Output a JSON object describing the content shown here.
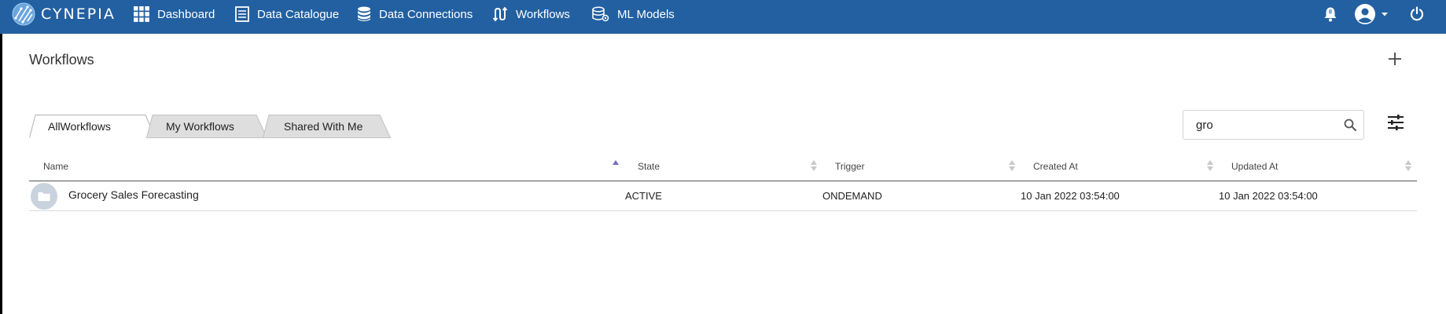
{
  "brand": {
    "name": "CYNEPIA"
  },
  "nav": [
    {
      "label": "Dashboard",
      "icon": "grid-icon"
    },
    {
      "label": "Data Catalogue",
      "icon": "catalogue-icon"
    },
    {
      "label": "Data Connections",
      "icon": "database-icon"
    },
    {
      "label": "Workflows",
      "icon": "workflow-icon"
    },
    {
      "label": "ML Models",
      "icon": "ml-models-icon"
    }
  ],
  "page": {
    "title": "Workflows"
  },
  "tabs": [
    {
      "label": "AllWorkflows",
      "active": true
    },
    {
      "label": "My Workflows",
      "active": false
    },
    {
      "label": "Shared With Me",
      "active": false
    }
  ],
  "search": {
    "value": "gro"
  },
  "table": {
    "columns": [
      "Name",
      "State",
      "Trigger",
      "Created At",
      "Updated At"
    ],
    "rows": [
      {
        "name": "Grocery Sales Forecasting",
        "state": "ACTIVE",
        "trigger": "ONDEMAND",
        "created_at": "10 Jan 2022 03:54:00",
        "updated_at": "10 Jan 2022 03:54:00"
      }
    ]
  },
  "colors": {
    "topbar": "#2260a1",
    "active_sort": "#6f6fc6",
    "inactive_tab": "#dedede"
  }
}
